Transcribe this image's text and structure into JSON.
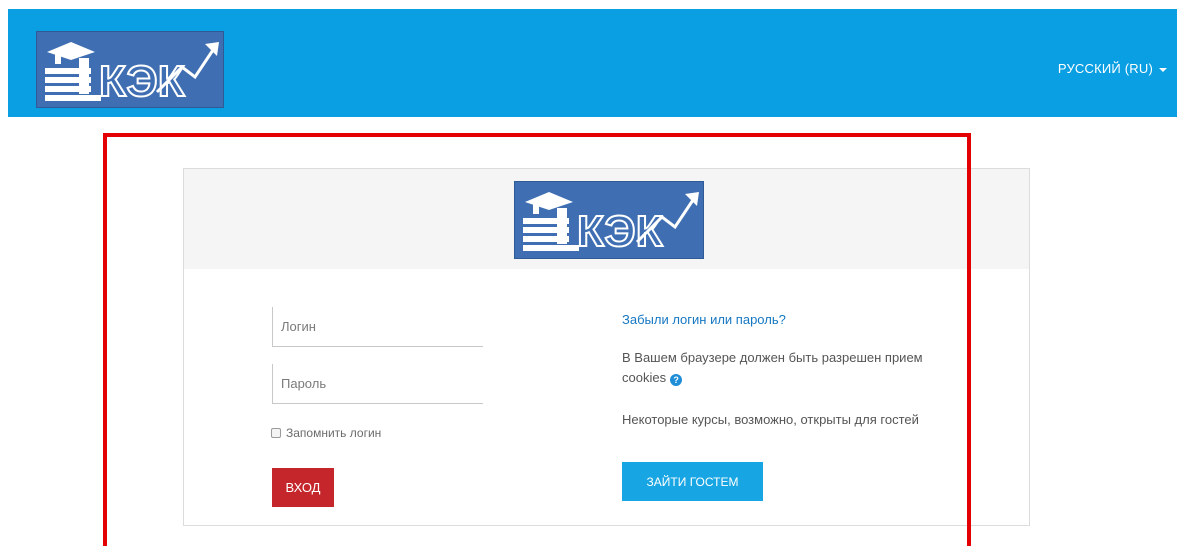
{
  "header": {
    "logo_text": "КЭК",
    "language": "РУССКИЙ (RU)"
  },
  "card": {
    "logo_text": "КЭК"
  },
  "form": {
    "username_placeholder": "Логин",
    "password_placeholder": "Пароль",
    "remember_label": "Запомнить логин",
    "login_button": "ВХОД"
  },
  "info": {
    "forgot_link": "Забыли логин или пароль?",
    "cookies_text": "В Вашем браузере должен быть разрешен прием cookies",
    "guests_text": "Некоторые курсы, возможно, открыты для гостей",
    "guest_button": "ЗАЙТИ ГОСТЕМ"
  },
  "colors": {
    "navbar": "#0a9fe3",
    "login_button": "#c4262b",
    "guest_button": "#17a6e3",
    "highlight": "#e30000",
    "link": "#1577c2"
  },
  "icons": {
    "lang_caret": "chevron-down-icon",
    "help": "question-circle-icon"
  }
}
